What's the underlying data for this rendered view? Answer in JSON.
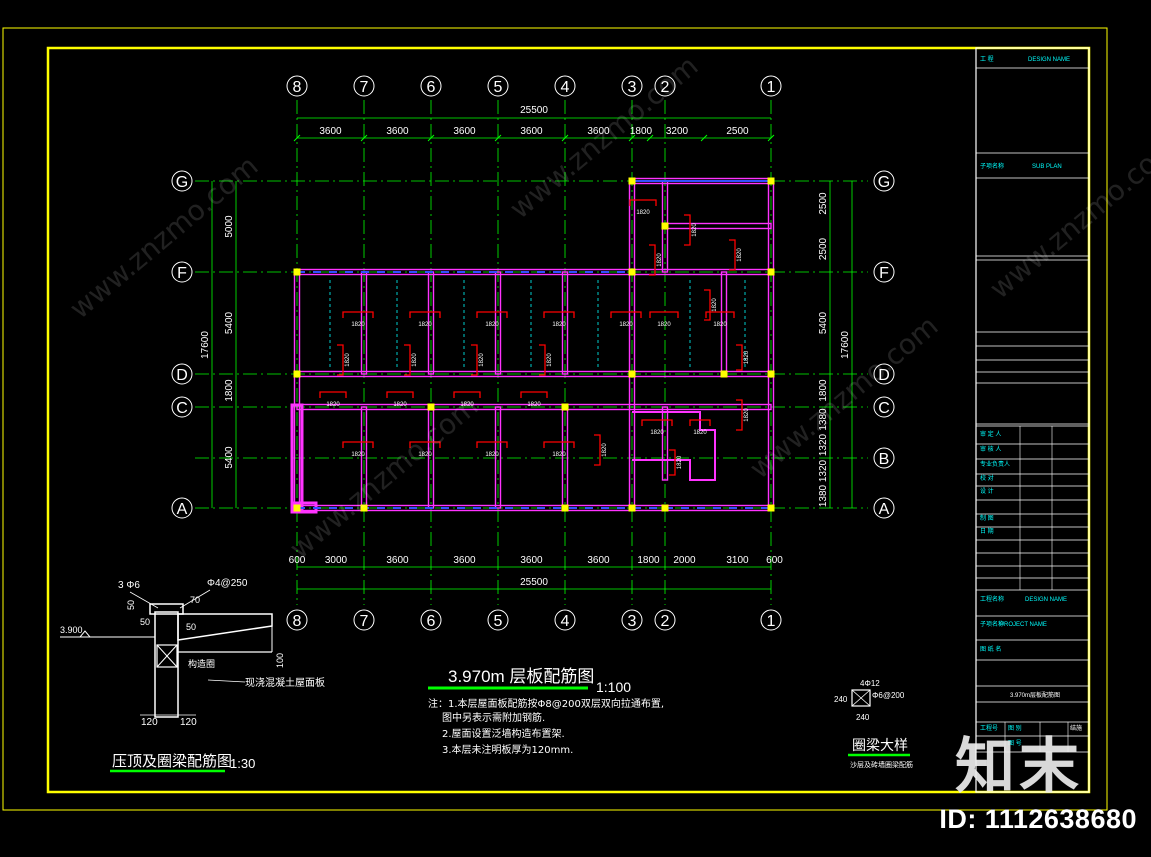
{
  "drawing": {
    "plan_title": "3.970m 层板配筋图",
    "plan_scale": "1:100",
    "notes": [
      "注：1.本层屋面板配筋按Φ8@200双层双向拉通布置,",
      "图中另表示需附加钢筋.",
      "2.屋面设置泛墙构造布置架.",
      "3.本层未注明板厚为120mm."
    ],
    "detail_left_title": "压顶及圈梁配筋图",
    "detail_left_scale": "1:30",
    "detail_right_title": "圈梁大样",
    "detail_right_sub": "沙层及砖墙圈梁配筋",
    "detail_labels": {
      "rebar_3phi6": "3 Φ6",
      "rebar_phi4": "Φ4@250",
      "elev_3900": "3.900",
      "dim_50a": "50",
      "dim_50b": "50",
      "dim_70": "70",
      "dim_100": "100",
      "dim_120a": "120",
      "dim_120b": "120",
      "gl_label": "构造圈",
      "slab_label": "现浇混凝土屋面板",
      "ring_4phi12": "4Φ12",
      "ring_stirrup": "Φ6@200",
      "ring_240": "240",
      "ring_240h": "240"
    },
    "grid_x_labels": [
      "8",
      "7",
      "6",
      "5",
      "4",
      "3",
      "2",
      "1"
    ],
    "grid_y_labels": [
      "G",
      "F",
      "D",
      "C",
      "B",
      "A"
    ],
    "dims_top_total": "25500",
    "dims_top": [
      "3600",
      "3600",
      "3600",
      "3600",
      "3600",
      "1800",
      "3200",
      "2500"
    ],
    "dims_bottom_total": "25500",
    "dims_bottom": [
      "600",
      "3000",
      "3600",
      "3600",
      "3600",
      "3600",
      "1800",
      "2000",
      "3100",
      "600"
    ],
    "dims_left": [
      "5000",
      "5400",
      "1800",
      "5400"
    ],
    "dims_left_total": "17600",
    "dims_right": [
      "2500",
      "2500",
      "5400",
      "1800",
      "1380",
      "1320",
      "1320",
      "1380"
    ],
    "dims_right_total": "17600",
    "slab_rebar_label": "1820"
  },
  "title_block": {
    "rows": [
      "工  程",
      "DESIGN NAME",
      "子项名称",
      "SUB PLAN",
      "审 定 人",
      "审 核 人",
      "专业负责人",
      "校 对",
      "设 计",
      "制 图",
      "日 期",
      "工程名称",
      "DESIGN NAME",
      "子项名称",
      "PROJECT NAME",
      "图 纸 名",
      "3.970m层板配筋图",
      "工程号",
      "图 别",
      "图 号",
      "结施"
    ]
  },
  "watermark": {
    "id_text": "ID: 1112638680",
    "logo_text": "知末",
    "site_text": "www.znzmo.com"
  },
  "colors": {
    "frame": "#ffff00",
    "grid": "#00ff00",
    "wall": "#ff33ff",
    "rebar": "#ff0000",
    "dim": "#ffffff",
    "column": "#ffff00",
    "cyan": "#00ffff",
    "blue": "#3050ff"
  }
}
